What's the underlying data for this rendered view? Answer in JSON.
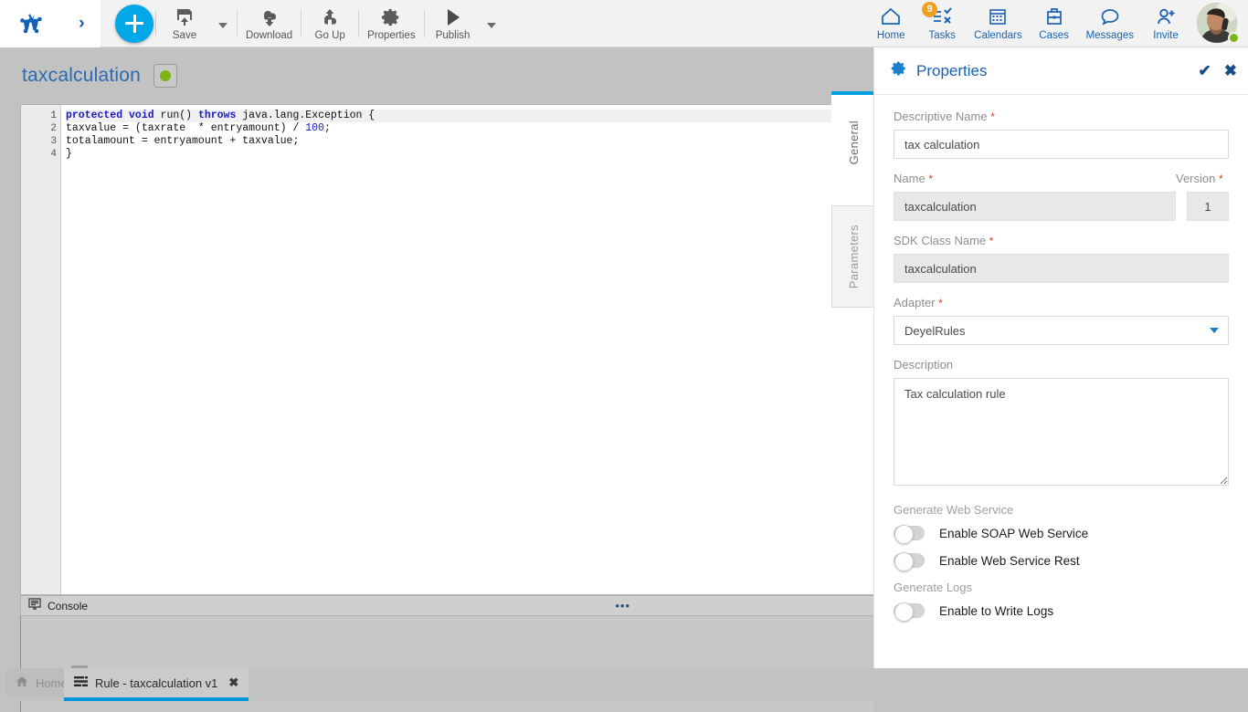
{
  "app": {
    "logo_icon": "deyel-node-logo",
    "nav_expand_icon": "chevron-right-icon",
    "add_button_icon": "plus-icon"
  },
  "toolbar": {
    "items": [
      {
        "icon": "save-floppy-icon",
        "label": "Save"
      },
      {
        "icon": "download-cloud-icon",
        "label": "Download"
      },
      {
        "icon": "upload-cloud-icon",
        "label": "Go Up"
      },
      {
        "icon": "gear-icon",
        "label": "Properties"
      },
      {
        "icon": "play-triangle-icon",
        "label": "Publish"
      }
    ],
    "save_dropdown_icon": "chevron-down-icon",
    "publish_dropdown_icon": "chevron-down-icon"
  },
  "nav": {
    "items": [
      {
        "icon": "home-icon",
        "label": "Home",
        "badge": ""
      },
      {
        "icon": "tasks-checklist-icon",
        "label": "Tasks",
        "badge": "9"
      },
      {
        "icon": "calendar-icon",
        "label": "Calendars",
        "badge": ""
      },
      {
        "icon": "briefcase-icon",
        "label": "Cases",
        "badge": ""
      },
      {
        "icon": "chat-bubble-icon",
        "label": "Messages",
        "badge": ""
      },
      {
        "icon": "invite-person-add-icon",
        "label": "Invite",
        "badge": ""
      }
    ],
    "avatar_icon": "user-avatar",
    "presence": "online"
  },
  "document": {
    "title": "taxcalculation",
    "status_indicator_icon": "status-dot-green",
    "status_color": "#7cb518"
  },
  "editor": {
    "lines": [
      {
        "no": "1",
        "foldable": true,
        "text": "protected void run() throws java.lang.Exception {"
      },
      {
        "no": "2",
        "foldable": false,
        "text": "taxvalue = (taxrate  * entryamount) / 100;"
      },
      {
        "no": "3",
        "foldable": false,
        "text": "totalamount = entryamount + taxvalue;"
      },
      {
        "no": "4",
        "foldable": false,
        "text": "}"
      }
    ]
  },
  "console": {
    "icon": "console-monitor-icon",
    "label": "Console",
    "menu_icon": "ellipsis-icon",
    "menu_glyph": "•••"
  },
  "side_tabs": [
    {
      "label": "General",
      "active": true
    },
    {
      "label": "Parameters",
      "active": false
    }
  ],
  "panel": {
    "icon": "gear-icon",
    "title": "Properties",
    "confirm_icon": "check-icon",
    "confirm_glyph": "✔",
    "close_icon": "close-x-icon",
    "close_glyph": "✖",
    "accent_color": "#1a62b3",
    "fields": {
      "descriptive_name": {
        "label": "Descriptive Name",
        "required": "*",
        "value": "tax calculation",
        "placeholder": ""
      },
      "name": {
        "label": "Name",
        "required": "*",
        "value": "taxcalculation",
        "readonly": true
      },
      "version": {
        "label": "Version",
        "required": "*",
        "value": "1",
        "readonly": true
      },
      "sdk_class_name": {
        "label": "SDK Class Name",
        "required": "*",
        "value": "taxcalculation",
        "readonly": true
      },
      "adapter": {
        "label": "Adapter",
        "required": "*",
        "value": "DeyelRules",
        "dropdown_icon": "chevron-down-icon"
      },
      "description": {
        "label": "Description",
        "required": "",
        "value": "Tax calculation rule",
        "placeholder": ""
      }
    },
    "sections": [
      {
        "title": "Generate Web Service",
        "toggles": [
          {
            "label": "Enable SOAP Web Service",
            "state": "off"
          },
          {
            "label": "Enable Web Service Rest",
            "state": "off"
          }
        ]
      },
      {
        "title": "Generate Logs",
        "toggles": [
          {
            "label": "Enable to Write Logs",
            "state": "off"
          }
        ]
      }
    ]
  },
  "taskbar": {
    "tabs": [
      {
        "icon": "home-icon",
        "label": "Home",
        "active": false,
        "closable": false
      },
      {
        "icon": "rule-lines-icon",
        "label": "Rule - taxcalculation v1",
        "active": true,
        "closable": true,
        "close_glyph": "✖"
      }
    ]
  }
}
